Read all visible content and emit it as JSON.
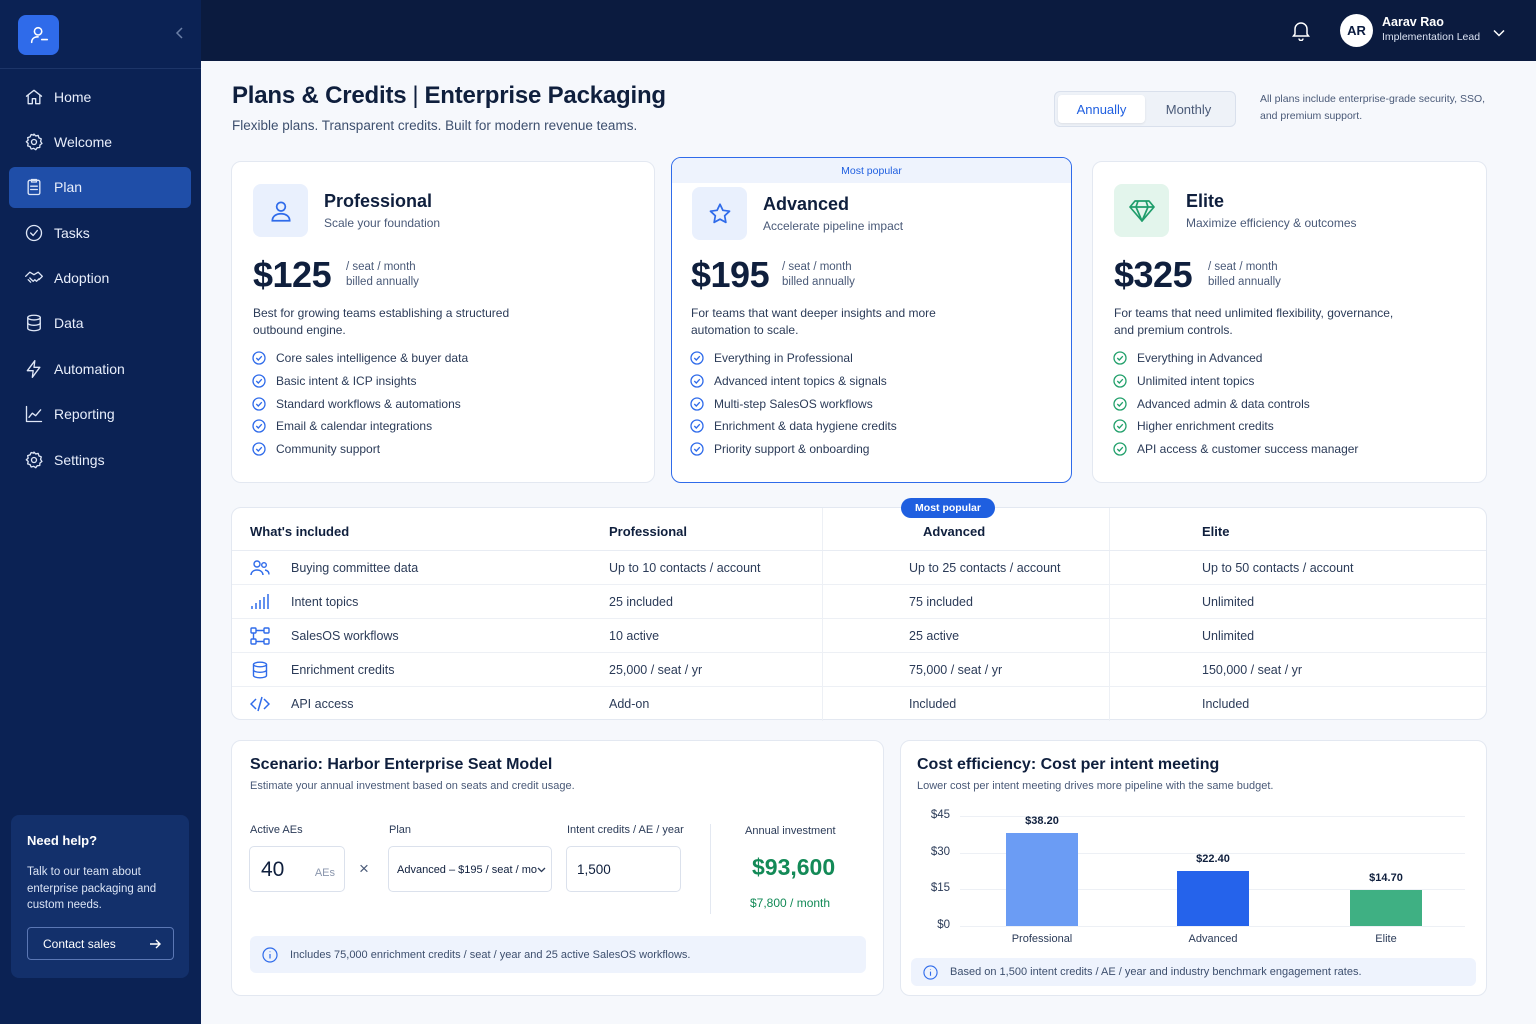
{
  "sidebar": {
    "items": [
      {
        "label": "Home",
        "icon": "home-icon"
      },
      {
        "label": "Welcome",
        "icon": "gear-icon"
      },
      {
        "label": "Plan",
        "icon": "clipboard-icon",
        "active": true
      },
      {
        "label": "Tasks",
        "icon": "check-circle-icon"
      },
      {
        "label": "Adoption",
        "icon": "handshake-icon"
      },
      {
        "label": "Data",
        "icon": "database-icon"
      },
      {
        "label": "Automation",
        "icon": "bolt-icon"
      },
      {
        "label": "Reporting",
        "icon": "chart-line-icon"
      },
      {
        "label": "Settings",
        "icon": "settings-icon"
      }
    ],
    "help": {
      "title": "Need help?",
      "text": "Talk to our team about enterprise packaging and custom needs.",
      "button": "Contact sales"
    }
  },
  "topbar": {
    "avatar": "AR",
    "user_name": "Aarav Rao",
    "user_role": "Implementation Lead"
  },
  "header": {
    "title_a": "Plans & Credits",
    "title_sep": "|",
    "title_b": "Enterprise Packaging",
    "subtitle": "Flexible plans. Transparent credits. Built for modern revenue teams.",
    "billing_options": [
      "Annually",
      "Monthly"
    ],
    "billing_selected": "Annually",
    "note": "All plans include enterprise-grade security, SSO, and premium support."
  },
  "plans": [
    {
      "name": "Professional",
      "tagline": "Scale your foundation",
      "price": "$125",
      "per_1": "/ seat / month",
      "per_2": "billed annually",
      "desc": "Best for growing teams establishing a structured outbound engine.",
      "features": [
        "Core sales intelligence & buyer data",
        "Basic intent & ICP insights",
        "Standard workflows & automations",
        "Email & calendar integrations",
        "Community support"
      ]
    },
    {
      "badge": "Most popular",
      "name": "Advanced",
      "tagline": "Accelerate pipeline impact",
      "price": "$195",
      "per_1": "/ seat / month",
      "per_2": "billed annually",
      "desc": "For teams that want deeper insights and more automation to scale.",
      "features": [
        "Everything in Professional",
        "Advanced intent topics & signals",
        "Multi-step SalesOS workflows",
        "Enrichment & data hygiene credits",
        "Priority support & onboarding"
      ]
    },
    {
      "name": "Elite",
      "tagline": "Maximize efficiency & outcomes",
      "price": "$325",
      "per_1": "/ seat / month",
      "per_2": "billed annually",
      "desc": "For teams that need unlimited flexibility, governance, and premium controls.",
      "features": [
        "Everything in Advanced",
        "Unlimited intent topics",
        "Advanced admin & data controls",
        "Higher enrichment credits",
        "API access & customer success manager"
      ]
    }
  ],
  "comparison": {
    "badge": "Most popular",
    "headers": [
      "What's included",
      "Professional",
      "Advanced",
      "Elite"
    ],
    "rows": [
      {
        "icon": "users-icon",
        "feature": "Buying committee data",
        "values": [
          "Up to 10 contacts / account",
          "Up to 25 contacts / account",
          "Up to 50 contacts / account"
        ]
      },
      {
        "icon": "signal-icon",
        "feature": "Intent topics",
        "values": [
          "25 included",
          "75 included",
          "Unlimited"
        ]
      },
      {
        "icon": "workflow-icon",
        "feature": "SalesOS workflows",
        "values": [
          "10 active",
          "25 active",
          "Unlimited"
        ]
      },
      {
        "icon": "database-icon",
        "feature": "Enrichment credits",
        "values": [
          "25,000 / seat / yr",
          "75,000 / seat / yr",
          "150,000 / seat / yr"
        ]
      },
      {
        "icon": "code-icon",
        "feature": "API access",
        "values": [
          "Add-on",
          "Included",
          "Included"
        ]
      }
    ]
  },
  "scenario": {
    "title": "Scenario: Harbor Enterprise Seat Model",
    "subtitle": "Estimate your annual investment based on seats and credit usage.",
    "aes_label": "Active AEs",
    "aes_value": "40",
    "aes_unit": "AEs",
    "times": "×",
    "plan_label": "Plan",
    "plan_value": "Advanced – $195 / seat / mo",
    "credits_label": "Intent credits / AE / year",
    "credits_value": "1,500",
    "invest_label": "Annual investment",
    "invest_value": "$93,600",
    "invest_month": "$7,800 / month",
    "info": "Includes 75,000 enrichment credits / seat / year and 25 active SalesOS workflows."
  },
  "efficiency": {
    "title": "Cost efficiency: Cost per intent meeting",
    "subtitle": "Lower cost per intent meeting drives more pipeline with the same budget.",
    "info": "Based on 1,500 intent credits / AE / year and industry benchmark engagement rates."
  },
  "chart_data": {
    "type": "bar",
    "categories": [
      "Professional",
      "Advanced",
      "Elite"
    ],
    "values": [
      38.2,
      22.4,
      14.7
    ],
    "value_labels": [
      "$38.20",
      "$22.40",
      "$14.70"
    ],
    "y_ticks": [
      "$45",
      "$30",
      "$15",
      "$0"
    ],
    "ylim": [
      0,
      45
    ],
    "colors": [
      "#6b9cf4",
      "#2563eb",
      "#3fb083"
    ],
    "grid": true
  },
  "colors": {
    "accent": "#1f5fe0",
    "sidebar": "#0b2254",
    "topbar": "#0b1b3f",
    "success": "#22a06b"
  }
}
